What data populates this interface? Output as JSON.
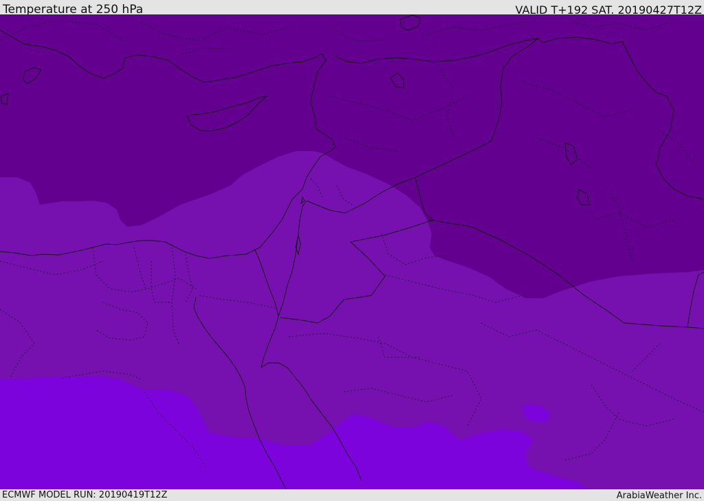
{
  "header": {
    "title": "Temperature at 250 hPa",
    "valid": "VALID T+192 SAT. 20190427T12Z"
  },
  "footer": {
    "model_run": "ECMWF MODEL RUN: 20190419T12Z",
    "credit": "ArabiaWeather Inc."
  },
  "colors": {
    "band_cold": "#63008f",
    "band_mid": "#7611b0",
    "band_warm": "#7d03dc",
    "background": "#e4e4e4"
  }
}
